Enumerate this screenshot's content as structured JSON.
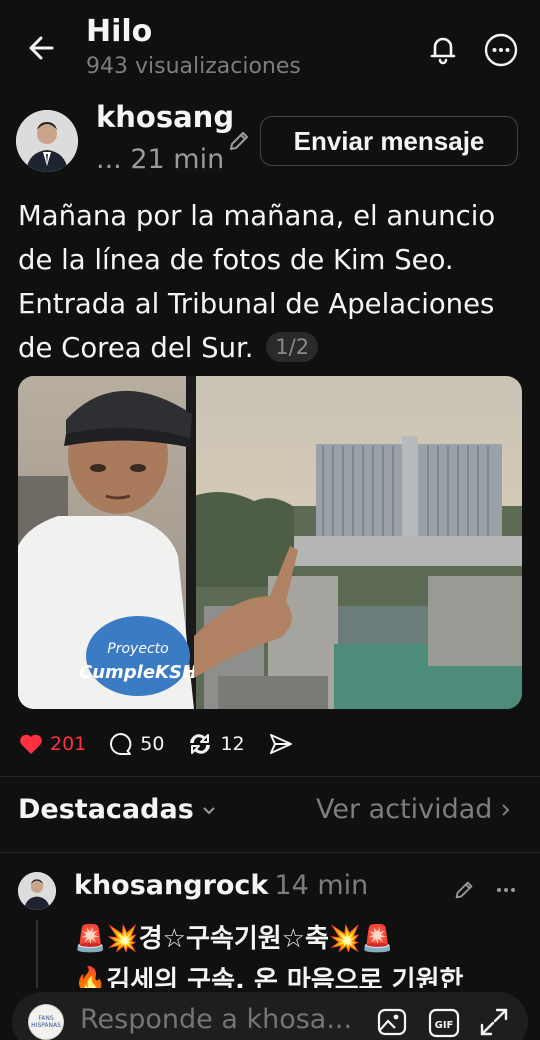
{
  "header": {
    "title": "Hilo",
    "views": "943 visualizaciones"
  },
  "post": {
    "author": "khosang",
    "meta": "... 21 min",
    "send_message_label": "Enviar mensaje",
    "text": "Mañana por la mañana, el anuncio de la línea de fotos de Kim Seo. Entrada al Tribunal de Apelaciones de Corea del Sur.",
    "page_indicator": "1/2",
    "shirt_text": "Proyecto CumpleKSH",
    "likes": "201",
    "comments": "50",
    "reposts": "12"
  },
  "tabs": {
    "featured": "Destacadas",
    "activity": "Ver actividad"
  },
  "reply": {
    "author": "khosangrock",
    "time": "14 min",
    "line1": "🚨💥경☆구속기원☆축💥🚨",
    "line2": "🔥김세의 구속, 온 마음으로 기원한"
  },
  "composer": {
    "placeholder": "Responde a khosa...",
    "avatar_text": "FANS HISPANAS",
    "gif_label": "GIF"
  },
  "colors": {
    "background": "#101010",
    "like": "#ff3040",
    "muted": "#7d7d7d"
  }
}
